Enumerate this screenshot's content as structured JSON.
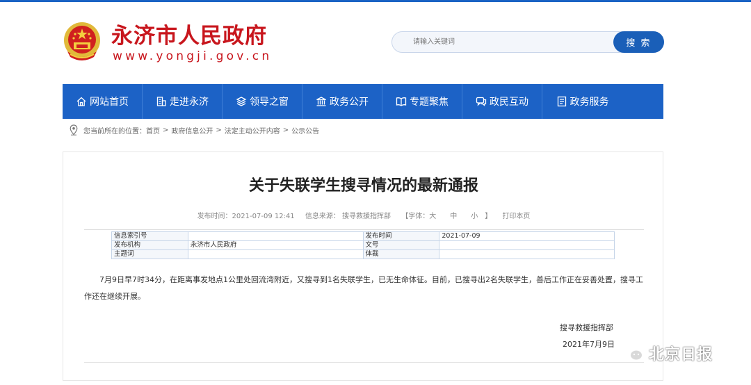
{
  "header": {
    "site_name": "永济市人民政府",
    "site_url": "www.yongji.gov.cn",
    "emblem_icon": "national-emblem-icon"
  },
  "search": {
    "placeholder": "请输入关键词",
    "button_label": "搜 索"
  },
  "nav": {
    "items": [
      {
        "label": "网站首页",
        "icon": "home-icon"
      },
      {
        "label": "走进永济",
        "icon": "building-icon"
      },
      {
        "label": "领导之窗",
        "icon": "layers-icon"
      },
      {
        "label": "政务公开",
        "icon": "government-icon"
      },
      {
        "label": "专题聚焦",
        "icon": "book-icon"
      },
      {
        "label": "政民互动",
        "icon": "chat-icon"
      },
      {
        "label": "政务服务",
        "icon": "service-icon"
      }
    ]
  },
  "breadcrumb": {
    "prefix": "您当前所在的位置：",
    "items": [
      "首页",
      "政府信息公开",
      "法定主动公开内容",
      "公示公告"
    ],
    "separator": ">"
  },
  "article": {
    "title": "关于失联学生搜寻情况的最新通报",
    "meta": {
      "publish_time": "发布时间：2021-07-09 12:41",
      "source": "信息来源： 搜寻救援指挥部",
      "font_label": "【字体：",
      "font_large": "大",
      "font_medium": "中",
      "font_small": "小",
      "font_close": "】",
      "print": "打印本页"
    },
    "info_table": {
      "row1": {
        "label1": "信息索引号",
        "value1": "",
        "label2": "发布时间",
        "value2": "2021-07-09"
      },
      "row2": {
        "label1": "发布机构",
        "value1": "永济市人民政府",
        "label2": "文号",
        "value2": ""
      },
      "row3": {
        "label1": "主题词",
        "value1": "",
        "label2": "体裁",
        "value2": ""
      }
    },
    "body": "7月9日早7时34分，在距离事发地点1公里处回流湾附近，又搜寻到1名失联学生，已无生命体征。目前，已搜寻出2名失联学生，善后工作正在妥善处置，搜寻工作还在继续开展。",
    "signature_org": "搜寻救援指挥部",
    "signature_date": "2021年7月9日"
  },
  "watermark": {
    "text": "北京日报",
    "icon": "wechat-icon"
  },
  "colors": {
    "brand_red": "#c8161d",
    "nav_blue": "#1c62c6",
    "button_blue": "#1a5fb8"
  }
}
